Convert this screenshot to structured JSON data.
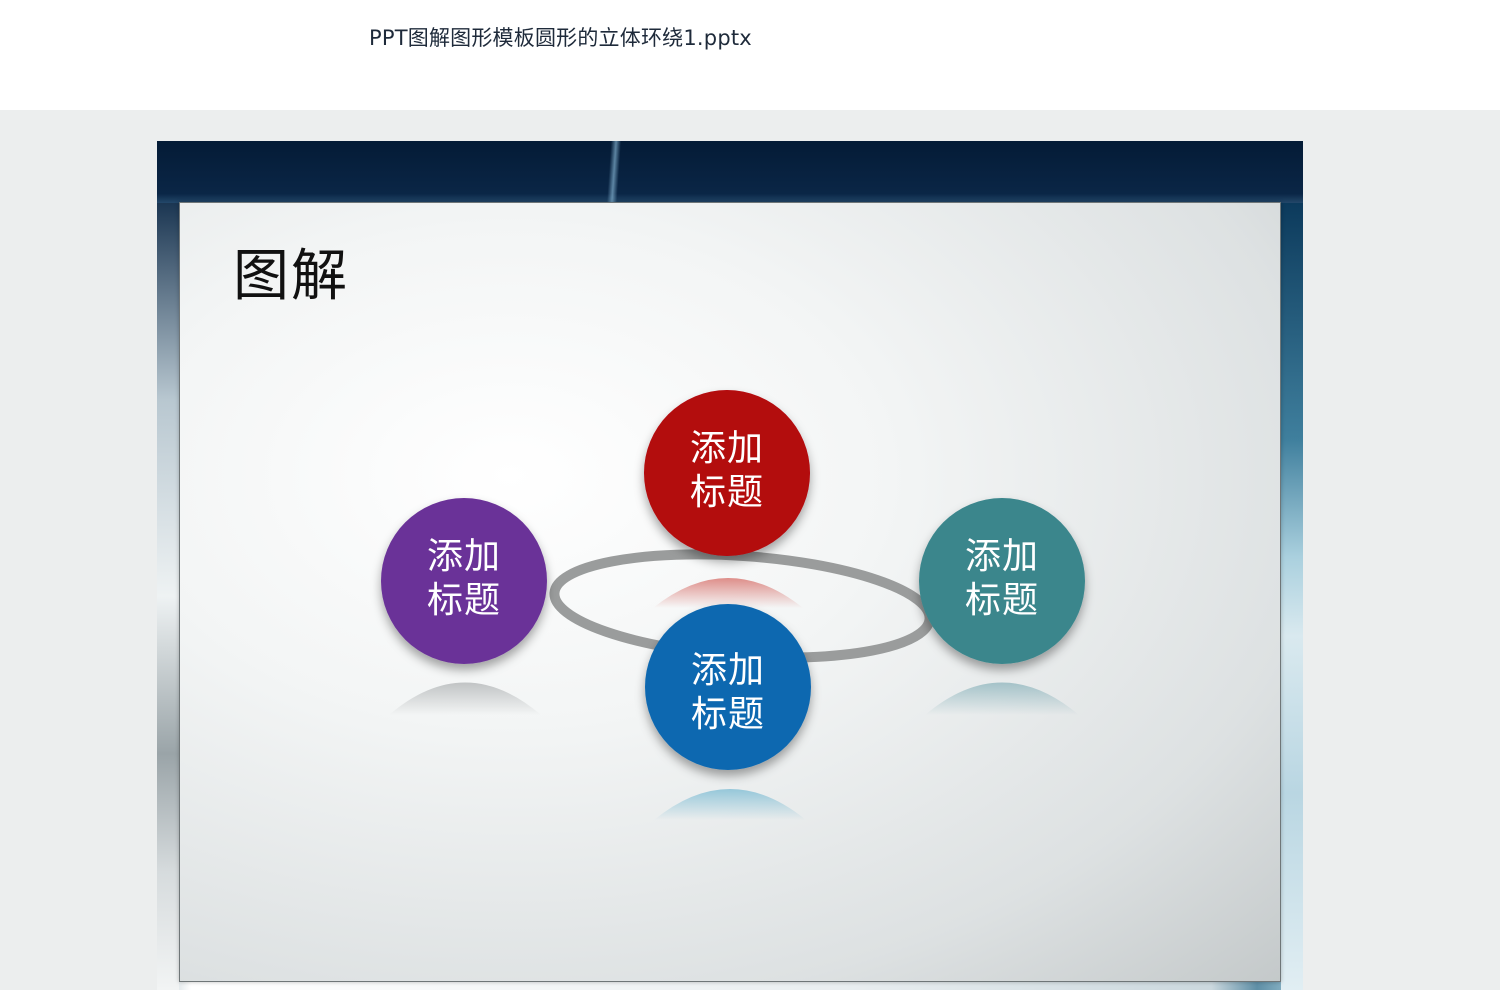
{
  "document": {
    "filename": "PPT图解图形模板圆形的立体环绕1.pptx"
  },
  "slide": {
    "title": "图解",
    "nodes": [
      {
        "label": "添加\n标题",
        "color": "#b3070c"
      },
      {
        "label": "添加\n标题",
        "color": "#6b3398"
      },
      {
        "label": "添加\n标题",
        "color": "#3a868c"
      },
      {
        "label": "添加\n标题",
        "color": "#0d68b0"
      }
    ],
    "ring_color": "#9a9c9c"
  }
}
